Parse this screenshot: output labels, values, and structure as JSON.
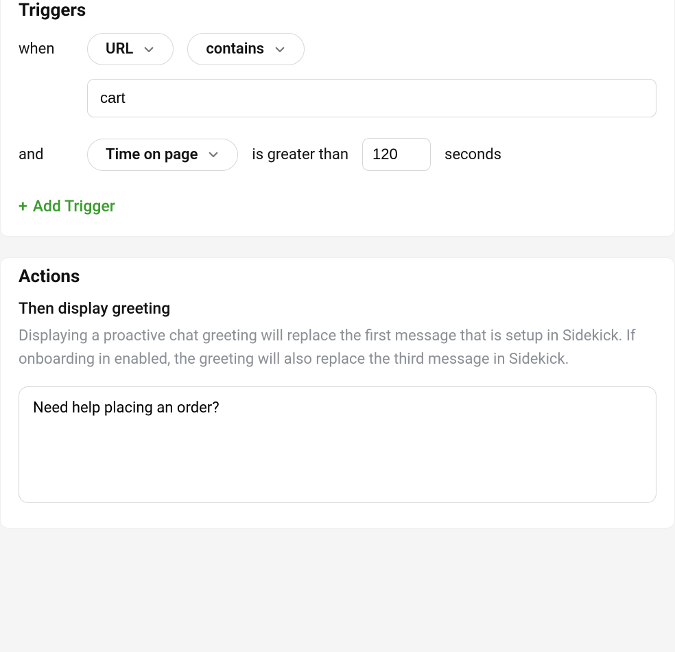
{
  "triggers": {
    "title": "Triggers",
    "when_label": "when",
    "type_select": "URL",
    "operator_select": "contains",
    "url_value": "cart",
    "and_label": "and",
    "time_select": "Time on page",
    "gt_text": "is greater than",
    "time_value": "120",
    "seconds_text": "seconds",
    "add_trigger_label": "Add Trigger"
  },
  "actions": {
    "title": "Actions",
    "subhead": "Then display greeting",
    "description": "Displaying a proactive chat greeting will replace the first message that is setup in Sidekick. If onboarding in enabled, the greeting will also replace the third message in Sidekick.",
    "greeting_value": "Need help placing an order?"
  }
}
